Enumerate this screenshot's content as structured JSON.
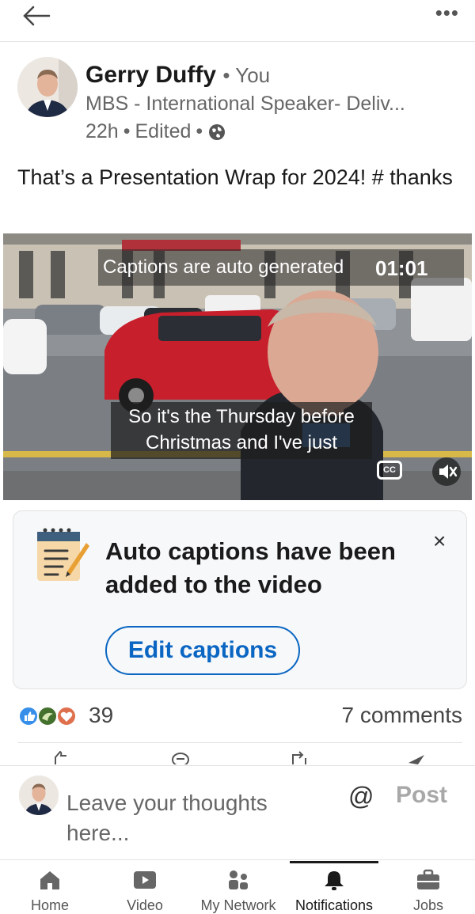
{
  "header": {
    "back_icon": "arrow-left-icon",
    "more_icon": "ellipsis-icon"
  },
  "post": {
    "author_name": "Gerry Duffy",
    "you_label": "• You",
    "headline": "MBS - International Speaker- Deliv...",
    "time": "22h",
    "edited": "Edited",
    "visibility_icon": "globe-icon",
    "text": "That’s a Presentation Wrap for 2024! # thanks"
  },
  "video": {
    "auto_generated_notice": "Captions are auto generated",
    "time": "01:01",
    "subtitle": "So it's the Thursday before Christmas and I've just",
    "cc_label": "CC",
    "mute_icon": "speaker-muted-icon"
  },
  "caption_card": {
    "title": "Auto captions have been added to the video",
    "close_label": "×",
    "edit_button": "Edit captions"
  },
  "social": {
    "reaction_count": "39",
    "comments": "7 comments",
    "reaction_colors": [
      "#378fe9",
      "#44712e",
      "#df704d"
    ]
  },
  "composer": {
    "placeholder": "Leave your thoughts here...",
    "mention": "@",
    "post_button": "Post"
  },
  "nav": {
    "items": [
      {
        "label": "Home",
        "icon": "home-icon"
      },
      {
        "label": "Video",
        "icon": "video-icon"
      },
      {
        "label": "My Network",
        "icon": "network-icon"
      },
      {
        "label": "Notifications",
        "icon": "bell-icon",
        "active": true
      },
      {
        "label": "Jobs",
        "icon": "briefcase-icon"
      }
    ]
  },
  "colors": {
    "accent": "#0a66c2",
    "text": "#1a1a1a",
    "muted": "#666666"
  }
}
